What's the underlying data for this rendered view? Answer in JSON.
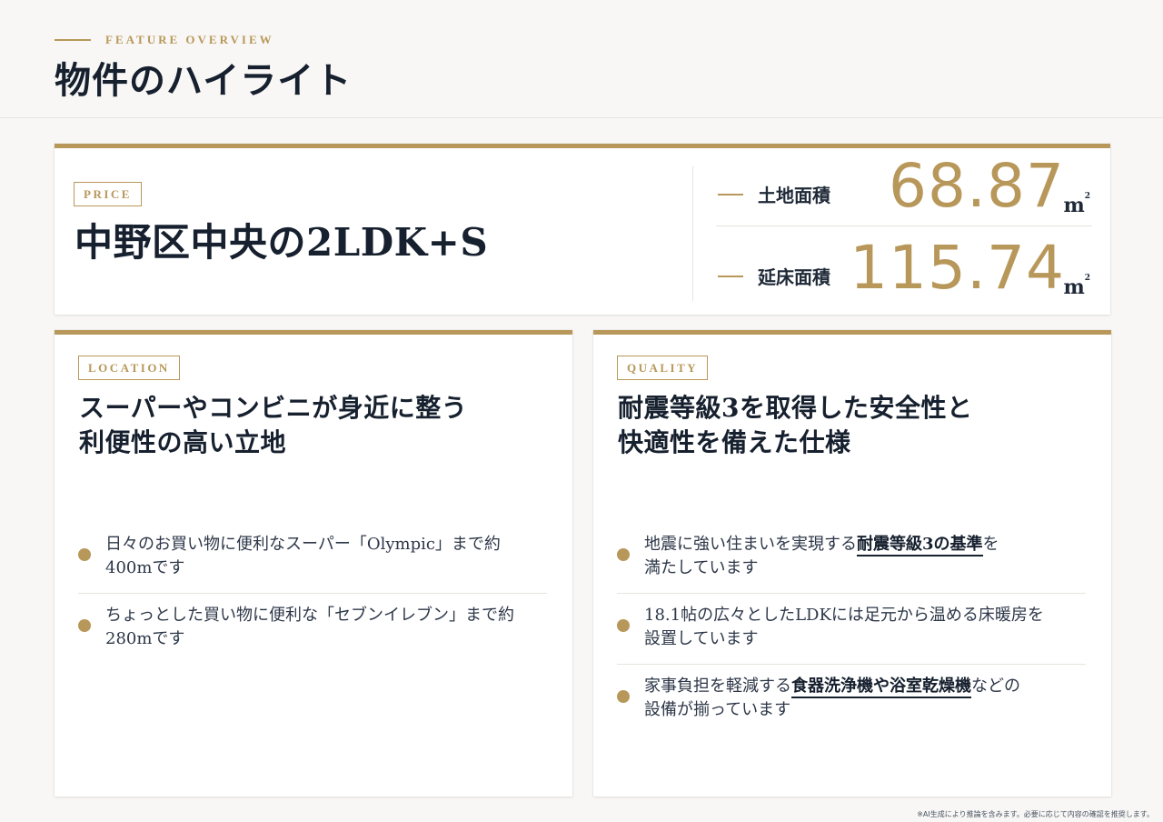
{
  "header": {
    "eyebrow": "FEATURE OVERVIEW",
    "title": "物件のハイライト"
  },
  "price": {
    "tag": "PRICE",
    "title": "中野区中央の2LDK+S",
    "areas": [
      {
        "label": "土地面積",
        "value": "68.87",
        "unit": "m",
        "unit_sup": "2"
      },
      {
        "label": "延床面積",
        "value": "115.74",
        "unit": "m",
        "unit_sup": "2"
      }
    ]
  },
  "location": {
    "tag": "LOCATION",
    "heading_line1": "スーパーやコンビニが身近に整う",
    "heading_line2": "利便性の高い立地",
    "items": [
      {
        "line1": "日々のお買い物に便利なスーパー「Olympic」まで約",
        "line2": "400mです"
      },
      {
        "line1": "ちょっとした買い物に便利な「セブンイレブン」まで約",
        "line2": "280mです"
      }
    ]
  },
  "quality": {
    "tag": "QUALITY",
    "heading_line1": "耐震等級3を取得した安全性と",
    "heading_line2": "快適性を備えた仕様",
    "items": [
      {
        "pre": "地震に強い住まいを実現する",
        "highlight": "耐震等級3の基準",
        "post": "を",
        "line2": "満たしています"
      },
      {
        "pre": "18.1帖の広々としたLDKには足元から温める床暖房を",
        "highlight": "",
        "post": "",
        "line2": "設置しています"
      },
      {
        "pre": "家事負担を軽減する",
        "highlight": "食器洗浄機や浴室乾燥機",
        "post": "などの",
        "line2": "設備が揃っています"
      }
    ]
  },
  "footnote": "※AI生成により推論を含みます。必要に応じて内容の確認を推奨します。",
  "colors": {
    "accent": "#b8985a",
    "text": "#16202e",
    "background": "#f8f7f5"
  }
}
